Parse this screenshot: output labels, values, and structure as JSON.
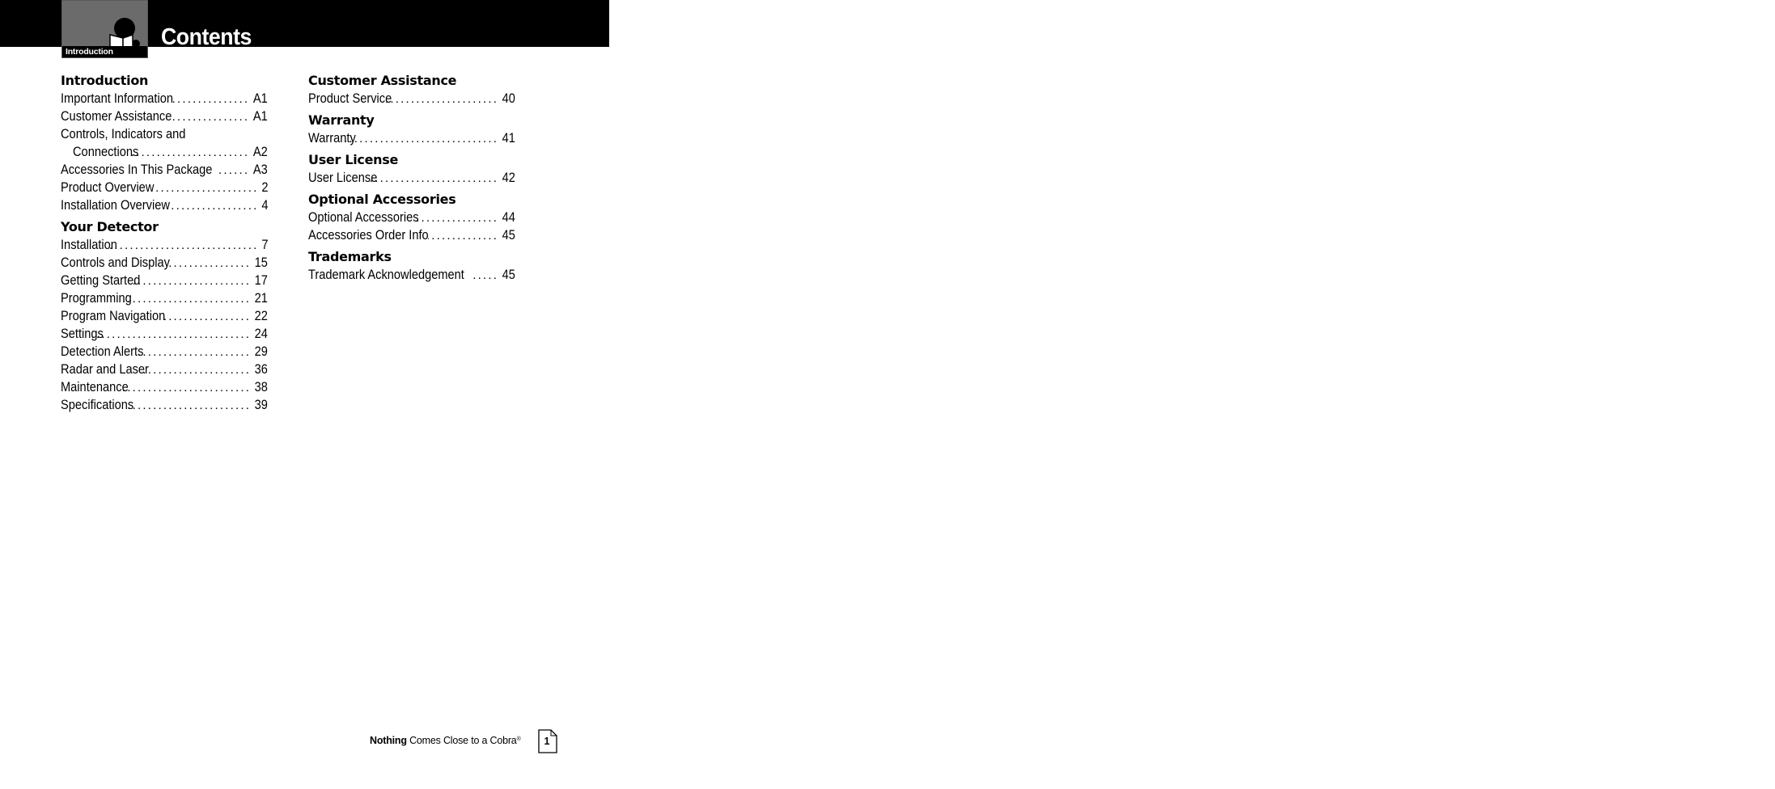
{
  "header": {
    "tab_label": "Introduction",
    "title": "Contents",
    "tab_icon": "reading-book-icon"
  },
  "left_column": [
    {
      "heading": "Introduction",
      "entries": [
        {
          "text": "Important Information",
          "page": "A1"
        },
        {
          "text": "Customer Assistance",
          "page": "A1"
        },
        {
          "text": "Controls, Indicators and",
          "continuation": "Connections",
          "page": "A2"
        },
        {
          "text": "Accessories In This Package",
          "page": "A3"
        },
        {
          "text": "Product Overview",
          "page": "2"
        },
        {
          "text": "Installation Overview",
          "page": "4"
        }
      ]
    },
    {
      "heading": "Your Detector",
      "entries": [
        {
          "text": "Installation",
          "page": "7"
        },
        {
          "text": "Controls and Display",
          "page": "15"
        },
        {
          "text": "Getting Started",
          "page": "17"
        },
        {
          "text": "Programming",
          "page": "21"
        },
        {
          "text": "Program Navigation",
          "page": "22"
        },
        {
          "text": "Settings",
          "page": "24"
        },
        {
          "text": "Detection Alerts",
          "page": "29"
        },
        {
          "text": "Radar and Laser",
          "page": "36"
        },
        {
          "text": "Maintenance",
          "page": "38"
        },
        {
          "text": "Specifications",
          "page": "39"
        }
      ]
    }
  ],
  "right_column": [
    {
      "heading": "Customer Assistance",
      "entries": [
        {
          "text": "Product Service",
          "page": "40"
        }
      ]
    },
    {
      "heading": "Warranty",
      "entries": [
        {
          "text": "Warranty",
          "page": "41"
        }
      ]
    },
    {
      "heading": "User License",
      "entries": [
        {
          "text": "User License",
          "page": "42"
        }
      ]
    },
    {
      "heading": "Optional Accessories",
      "entries": [
        {
          "text": "Optional Accessories",
          "page": "44"
        },
        {
          "text": "Accessories Order Info",
          "page": "45"
        }
      ]
    },
    {
      "heading": "Trademarks",
      "entries": [
        {
          "text": "Trademark Acknowledgement",
          "page": "45"
        }
      ]
    }
  ],
  "footer": {
    "slogan_bold": "Nothing",
    "slogan_rest": "Comes Close to a Cobra",
    "registered_mark": "®",
    "page_number": "1",
    "page_icon": "page-icon"
  },
  "dot_leader": "........................................"
}
